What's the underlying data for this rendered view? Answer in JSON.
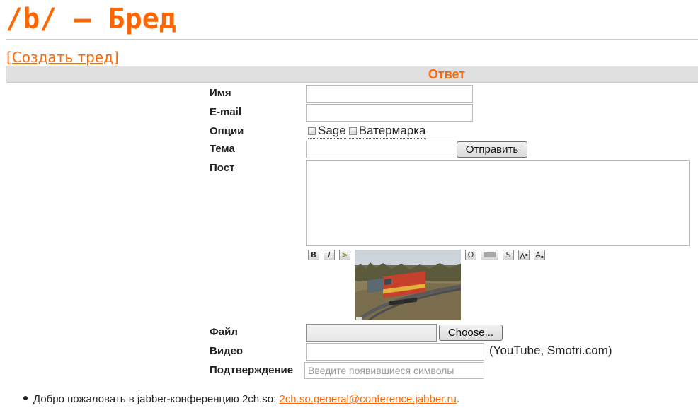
{
  "header": {
    "board_title": "/b/ – Бред",
    "create_thread_link": "Создать тред",
    "create_thread_open": "[",
    "create_thread_close": "]"
  },
  "reply_form": {
    "heading": "Ответ",
    "name_label": "Имя",
    "email_label": "E-mail",
    "options_label": "Опции",
    "option_sage": "Sage",
    "option_watermark": "Ватермарка",
    "subject_label": "Тема",
    "submit_button": "Отправить",
    "post_label": "Пост",
    "file_label": "Файл",
    "file_button": "Choose...",
    "video_label": "Видео",
    "video_hint": "(YouTube, Smotri.com)",
    "captcha_label": "Подтверждение",
    "captcha_placeholder": "Введите появившиеся символы"
  },
  "toolbar": {
    "bold_icon": "B",
    "italic_icon": "I",
    "quote_icon": ">",
    "spoiler_icon": "O",
    "strike_icon": "S",
    "sup_icon": "A",
    "sub_icon": "A"
  },
  "footer": {
    "jabber_text": "Добро пожаловать в jabber-конференцию 2ch.so: ",
    "jabber_link": "2ch.so.general@conference.jabber.ru",
    "jabber_end": "."
  },
  "colors": {
    "accent": "#ff6600",
    "bar": "#e0e0e0"
  }
}
